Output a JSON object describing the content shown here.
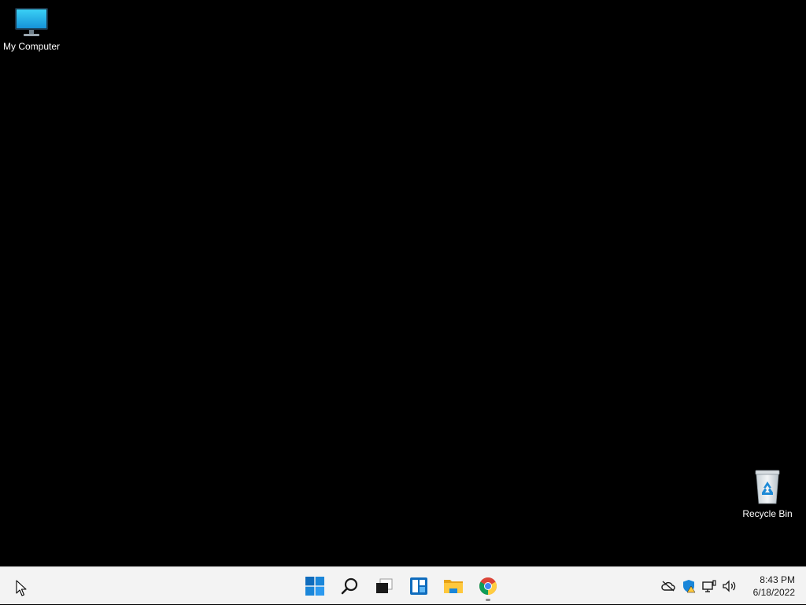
{
  "desktop": {
    "icons": [
      {
        "label": "My Computer",
        "icon": "monitor-icon"
      },
      {
        "label": "Recycle Bin",
        "icon": "recycle-bin-icon"
      }
    ]
  },
  "taskbar": {
    "apps": [
      {
        "name": "Start",
        "icon": "windows-start-icon"
      },
      {
        "name": "Search",
        "icon": "search-icon"
      },
      {
        "name": "Task View",
        "icon": "task-view-icon"
      },
      {
        "name": "Widgets",
        "icon": "widgets-icon"
      },
      {
        "name": "File Explorer",
        "icon": "folder-icon"
      },
      {
        "name": "Google Chrome",
        "icon": "chrome-icon",
        "active": true
      }
    ],
    "tray": {
      "icons": [
        "onedrive-offline-icon",
        "security-warning-icon",
        "network-icon",
        "volume-icon"
      ]
    },
    "clock": {
      "time": "8:43 PM",
      "date": "6/18/2022"
    }
  },
  "colors": {
    "desktop_bg": "#000000",
    "taskbar_bg": "#f3f3f3",
    "accent": "#0078d4"
  }
}
